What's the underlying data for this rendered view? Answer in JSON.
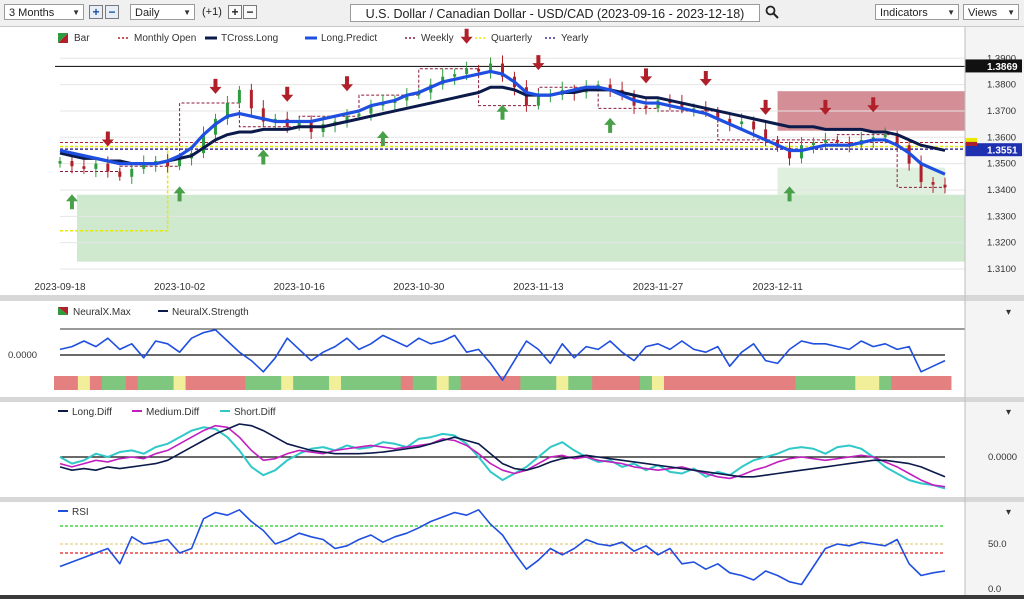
{
  "toolbar": {
    "period": "3 Months",
    "interval": "Daily",
    "offset": "(+1)",
    "title": "U.S. Dollar / Canadian Dollar - USD/CAD (2023-09-16 - 2023-12-18)",
    "indicators_label": "Indicators",
    "views_label": "Views"
  },
  "colors": {
    "price_up": "#2e9b3e",
    "price_down": "#b0202a",
    "tcross_long": "#0b1a4a",
    "long_predict": "#1f4fe0",
    "monthly_open": "#b0202a",
    "weekly": "#8a1a3a",
    "quarterly": "#e8e800",
    "yearly": "#3a2aa0",
    "up_zone": "#bfe2bf",
    "down_zone": "#c46a72"
  },
  "chart_data": [
    {
      "type": "line",
      "title": "U.S. Dollar / Canadian Dollar - USD/CAD (2023-09-16 - 2023-12-18)",
      "legend": [
        "Bar",
        "Monthly Open",
        "TCross.Long",
        "Long.Predict",
        "Weekly",
        "Quarterly",
        "Yearly"
      ],
      "x_ticks": [
        "2023-09-18",
        "2023-10-02",
        "2023-10-16",
        "2023-10-30",
        "2023-11-13",
        "2023-11-27",
        "2023-12-11"
      ],
      "y_ticks": [
        "1.3900",
        "1.3800",
        "1.3700",
        "1.3600",
        "1.3500",
        "1.3400",
        "1.3300",
        "1.3200",
        "1.3100"
      ],
      "ylim": [
        1.31,
        1.392
      ],
      "price_labels": [
        "1.3869",
        "1.3551"
      ],
      "close": [
        1.351,
        1.349,
        1.348,
        1.35,
        1.347,
        1.345,
        1.348,
        1.35,
        1.351,
        1.349,
        1.352,
        1.354,
        1.361,
        1.367,
        1.373,
        1.378,
        1.371,
        1.366,
        1.367,
        1.364,
        1.366,
        1.362,
        1.365,
        1.366,
        1.368,
        1.369,
        1.372,
        1.373,
        1.374,
        1.376,
        1.377,
        1.38,
        1.383,
        1.384,
        1.386,
        1.385,
        1.388,
        1.383,
        1.379,
        1.372,
        1.376,
        1.376,
        1.378,
        1.377,
        1.379,
        1.38,
        1.378,
        1.376,
        1.372,
        1.371,
        1.374,
        1.373,
        1.371,
        1.371,
        1.37,
        1.367,
        1.365,
        1.366,
        1.363,
        1.359,
        1.356,
        1.352,
        1.357,
        1.358,
        1.359,
        1.358,
        1.357,
        1.359,
        1.36,
        1.361,
        1.357,
        1.35,
        1.343,
        1.342,
        1.341
      ],
      "series": [
        {
          "name": "TCross.Long",
          "values": [
            1.354,
            1.353,
            1.352,
            1.352,
            1.351,
            1.351,
            1.35,
            1.35,
            1.35,
            1.351,
            1.352,
            1.353,
            1.356,
            1.359,
            1.361,
            1.362,
            1.362,
            1.363,
            1.363,
            1.363,
            1.364,
            1.364,
            1.364,
            1.365,
            1.366,
            1.367,
            1.368,
            1.369,
            1.37,
            1.371,
            1.372,
            1.373,
            1.374,
            1.375,
            1.376,
            1.377,
            1.379,
            1.379,
            1.378,
            1.376,
            1.376,
            1.376,
            1.377,
            1.377,
            1.378,
            1.378,
            1.378,
            1.377,
            1.376,
            1.375,
            1.375,
            1.374,
            1.373,
            1.372,
            1.371,
            1.37,
            1.369,
            1.368,
            1.367,
            1.366,
            1.365,
            1.364,
            1.364,
            1.364,
            1.363,
            1.363,
            1.363,
            1.363,
            1.362,
            1.362,
            1.361,
            1.359,
            1.357,
            1.356,
            1.355
          ]
        },
        {
          "name": "Long.Predict",
          "values": [
            1.355,
            1.354,
            1.353,
            1.352,
            1.351,
            1.35,
            1.35,
            1.35,
            1.35,
            1.351,
            1.353,
            1.356,
            1.361,
            1.365,
            1.368,
            1.369,
            1.368,
            1.367,
            1.366,
            1.366,
            1.366,
            1.366,
            1.367,
            1.368,
            1.369,
            1.37,
            1.372,
            1.373,
            1.374,
            1.376,
            1.377,
            1.379,
            1.381,
            1.382,
            1.383,
            1.384,
            1.385,
            1.384,
            1.381,
            1.377,
            1.376,
            1.376,
            1.377,
            1.378,
            1.379,
            1.379,
            1.378,
            1.376,
            1.374,
            1.373,
            1.373,
            1.372,
            1.371,
            1.37,
            1.369,
            1.367,
            1.365,
            1.363,
            1.361,
            1.359,
            1.357,
            1.355,
            1.355,
            1.356,
            1.357,
            1.357,
            1.357,
            1.358,
            1.359,
            1.359,
            1.357,
            1.354,
            1.35,
            1.348,
            1.346
          ]
        }
      ],
      "levels": {
        "monthly_open": 1.358,
        "weekly": 1.356,
        "quarterly": 1.3565,
        "yearly": 1.3555,
        "top_line": 1.3869
      }
    },
    {
      "type": "line",
      "legend": [
        "NeuralX.Max",
        "NeuralX.Strength"
      ],
      "y_ticks": [
        "0.0000"
      ],
      "series": [
        {
          "name": "NeuralX.Strength",
          "values": [
            0.2,
            0.3,
            0.5,
            0.3,
            0.6,
            0.2,
            0.4,
            -0.1,
            0.5,
            0.4,
            0.1,
            0.6,
            0.8,
            0.9,
            0.5,
            0.1,
            -0.2,
            -0.6,
            -0.1,
            0.6,
            0.2,
            -0.2,
            0.1,
            0.3,
            0.6,
            0.2,
            0.4,
            0.7,
            0.5,
            0.3,
            0.6,
            0.4,
            0.5,
            0.7,
            0.1,
            0.2,
            -0.3,
            -0.9,
            -0.2,
            0.5,
            0.2,
            -0.3,
            0.4,
            -0.1,
            0.3,
            0.2,
            0.5,
            0.1,
            -0.2,
            0.3,
            0.4,
            0.2,
            0.5,
            0.2,
            0.1,
            0.3,
            -0.4,
            0.1,
            0.4,
            -0.2,
            -0.3,
            0.2,
            0.5,
            0.4,
            0.4,
            0.3,
            0.2,
            0.5,
            0.3,
            0.4,
            0.2,
            0.3,
            -0.6,
            -0.4,
            -0.2
          ]
        },
        {
          "name": "NeuralX.Max",
          "values": [
            -1,
            -1,
            0,
            -1,
            1,
            1,
            -1,
            1,
            1,
            1,
            0,
            -1,
            -1,
            -1,
            -1,
            -1,
            1,
            1,
            1,
            0,
            1,
            1,
            1,
            0,
            1,
            1,
            1,
            1,
            1,
            -1,
            1,
            1,
            0,
            1,
            -1,
            -1,
            -1,
            -1,
            -1,
            1,
            1,
            1,
            0,
            1,
            1,
            -1,
            -1,
            -1,
            -1,
            1,
            0,
            -1,
            -1,
            -1,
            -1,
            -1,
            -1,
            -1,
            -1,
            -1,
            -1,
            -1,
            1,
            1,
            1,
            1,
            1,
            0,
            0,
            1,
            -1,
            -1,
            -1,
            -1,
            -1
          ]
        }
      ]
    },
    {
      "type": "line",
      "legend": [
        "Long.Diff",
        "Medium.Diff",
        "Short.Diff"
      ],
      "y_ticks": [
        "0.0000"
      ],
      "series": [
        {
          "name": "Long.Diff",
          "values": [
            -0.3,
            -0.4,
            -0.35,
            -0.4,
            -0.3,
            -0.35,
            -0.3,
            -0.25,
            -0.2,
            -0.1,
            0.1,
            0.3,
            0.5,
            0.7,
            0.85,
            1.0,
            0.95,
            0.8,
            0.6,
            0.4,
            0.3,
            0.2,
            0.15,
            0.1,
            0.1,
            0.1,
            0.12,
            0.15,
            0.2,
            0.25,
            0.3,
            0.4,
            0.5,
            0.6,
            0.5,
            0.4,
            0.1,
            -0.2,
            -0.35,
            -0.4,
            -0.3,
            -0.15,
            -0.05,
            0.0,
            0.05,
            0.0,
            -0.05,
            -0.1,
            -0.15,
            -0.2,
            -0.25,
            -0.3,
            -0.35,
            -0.4,
            -0.45,
            -0.5,
            -0.55,
            -0.6,
            -0.6,
            -0.55,
            -0.5,
            -0.45,
            -0.4,
            -0.35,
            -0.3,
            -0.25,
            -0.2,
            -0.15,
            -0.1,
            -0.1,
            -0.15,
            -0.2,
            -0.3,
            -0.45,
            -0.6
          ]
        },
        {
          "name": "Medium.Diff",
          "values": [
            -0.2,
            -0.3,
            -0.2,
            -0.1,
            -0.15,
            -0.05,
            0.0,
            -0.05,
            0.1,
            0.2,
            0.4,
            0.6,
            0.8,
            0.95,
            0.9,
            0.6,
            0.2,
            -0.1,
            -0.05,
            0.1,
            0.2,
            0.15,
            0.1,
            0.2,
            0.25,
            0.3,
            0.35,
            0.3,
            0.25,
            0.3,
            0.35,
            0.4,
            0.55,
            0.5,
            0.35,
            0.1,
            -0.2,
            -0.4,
            -0.5,
            -0.4,
            -0.2,
            0.0,
            0.05,
            -0.05,
            0.0,
            -0.1,
            -0.15,
            -0.2,
            -0.3,
            -0.35,
            -0.4,
            -0.35,
            -0.3,
            -0.4,
            -0.5,
            -0.6,
            -0.65,
            -0.55,
            -0.4,
            -0.3,
            -0.15,
            -0.05,
            0.0,
            -0.05,
            -0.1,
            -0.05,
            0.0,
            0.05,
            0.0,
            -0.15,
            -0.3,
            -0.5,
            -0.7,
            -0.85,
            -0.9
          ]
        },
        {
          "name": "Short.Diff",
          "values": [
            0.0,
            -0.2,
            -0.1,
            0.1,
            0.0,
            0.15,
            0.2,
            0.1,
            0.3,
            0.4,
            0.6,
            0.8,
            0.9,
            0.85,
            0.6,
            0.2,
            -0.3,
            -0.55,
            -0.4,
            -0.1,
            0.1,
            0.25,
            0.3,
            0.2,
            0.35,
            0.25,
            0.3,
            0.45,
            0.4,
            0.3,
            0.55,
            0.6,
            0.7,
            0.65,
            0.4,
            0.0,
            -0.45,
            -0.7,
            -0.5,
            -0.3,
            0.0,
            0.3,
            0.45,
            0.2,
            0.0,
            -0.15,
            -0.1,
            -0.3,
            -0.2,
            -0.4,
            -0.25,
            -0.45,
            -0.5,
            -0.35,
            -0.6,
            -0.45,
            -0.55,
            -0.3,
            -0.1,
            0.0,
            0.1,
            0.25,
            0.3,
            0.25,
            0.1,
            0.3,
            0.35,
            0.25,
            0.0,
            -0.3,
            -0.5,
            -0.7,
            -0.8,
            -0.85,
            -0.95
          ]
        }
      ]
    },
    {
      "type": "line",
      "legend": [
        "RSI"
      ],
      "y_ticks": [
        "50.0",
        "0.0"
      ],
      "ylim": [
        0,
        100
      ],
      "levels": {
        "upper": 70,
        "middle": 50,
        "lower": 40
      },
      "series": [
        {
          "name": "RSI",
          "values": [
            25,
            30,
            35,
            40,
            45,
            28,
            58,
            50,
            52,
            55,
            40,
            45,
            78,
            85,
            82,
            88,
            75,
            65,
            50,
            55,
            62,
            58,
            55,
            45,
            48,
            55,
            60,
            52,
            58,
            62,
            68,
            75,
            80,
            85,
            82,
            88,
            72,
            60,
            40,
            22,
            32,
            45,
            38,
            45,
            55,
            50,
            48,
            52,
            42,
            48,
            38,
            45,
            28,
            30,
            22,
            28,
            18,
            15,
            10,
            20,
            15,
            8,
            5,
            25,
            45,
            50,
            48,
            52,
            50,
            48,
            55,
            28,
            15,
            18,
            20
          ]
        }
      ]
    }
  ]
}
